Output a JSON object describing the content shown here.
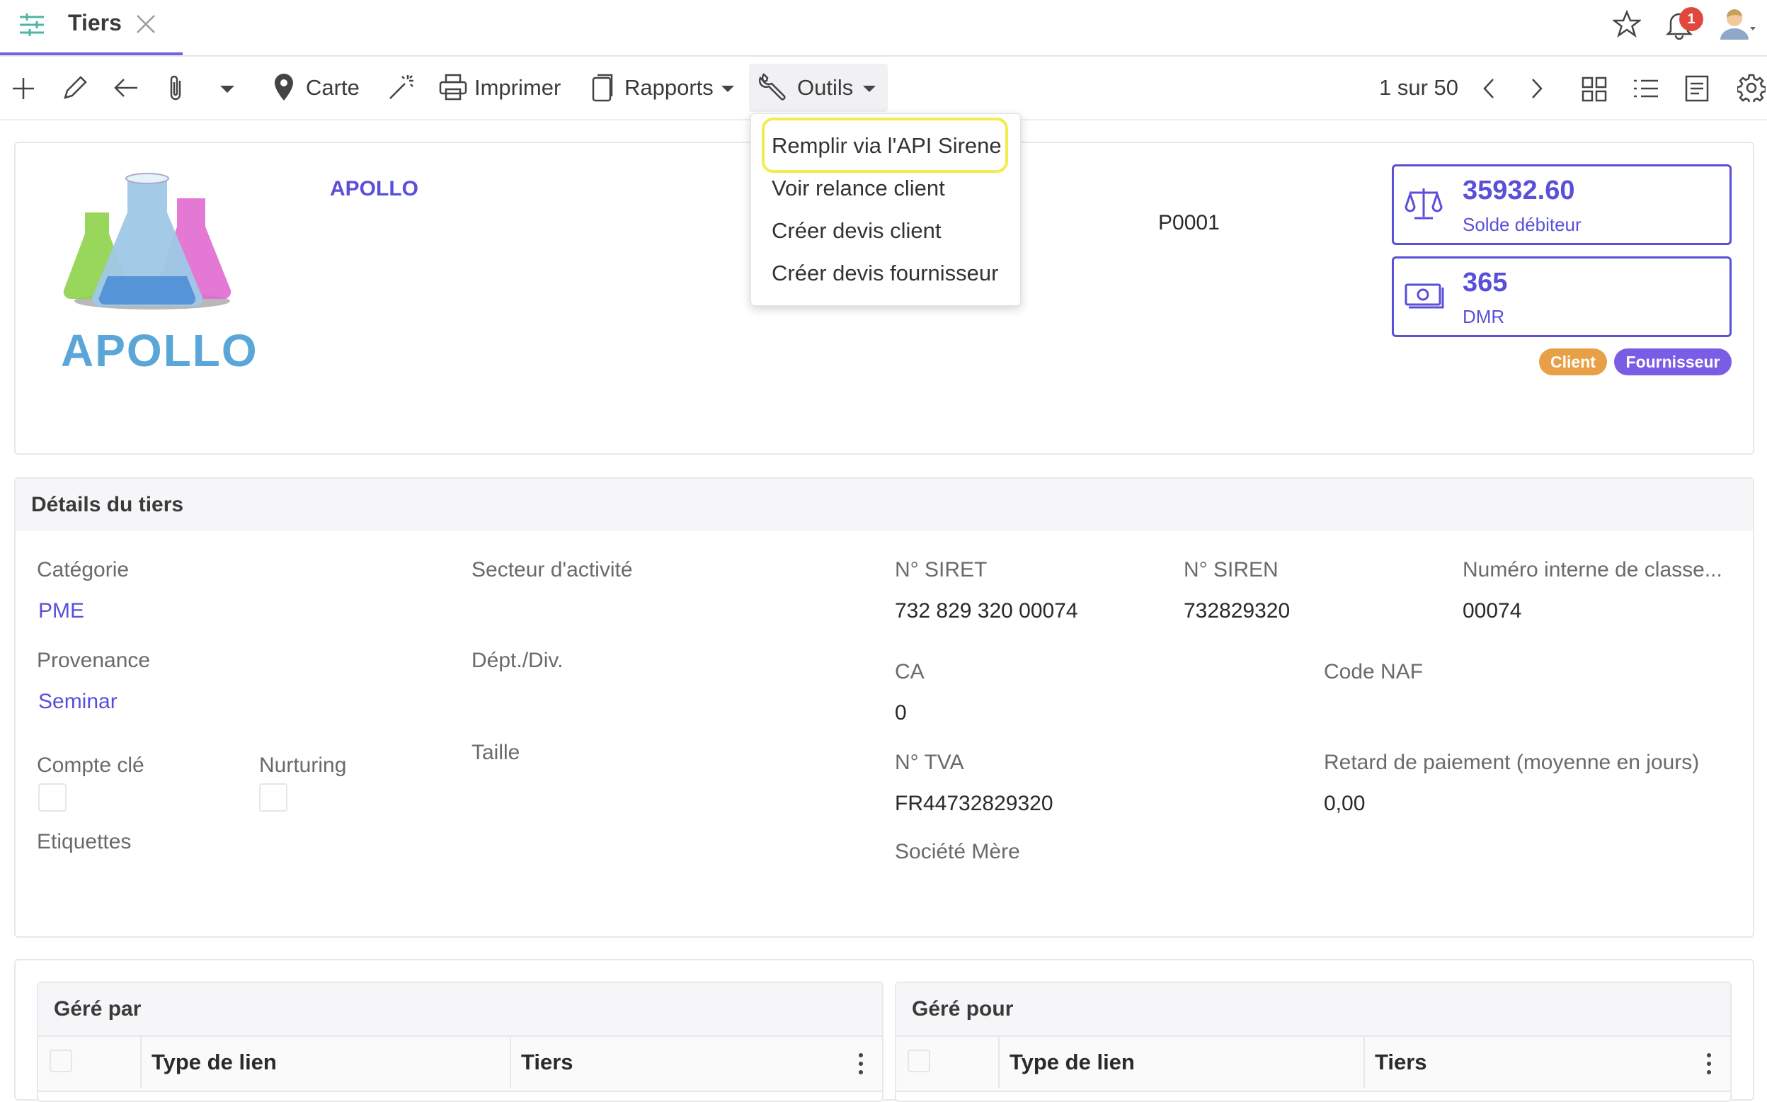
{
  "tab": {
    "title": "Tiers"
  },
  "header": {
    "notifications_count": "1"
  },
  "toolbar": {
    "carte": "Carte",
    "imprimer": "Imprimer",
    "rapports": "Rapports",
    "outils": "Outils",
    "pagination": "1 sur 50"
  },
  "outils_menu": {
    "items": [
      "Remplir via l'API Sirene",
      "Voir relance client",
      "Créer devis client",
      "Créer devis fournisseur"
    ]
  },
  "partner": {
    "logo_text": "APOLLO",
    "name": "APOLLO",
    "code": "P0001"
  },
  "kpis": [
    {
      "value": "35932.60",
      "label": "Solde débiteur",
      "icon": "balance-scale-icon"
    },
    {
      "value": "365",
      "label": "DMR",
      "icon": "money-icon"
    }
  ],
  "badges": [
    {
      "label": "Client",
      "color": "#e8a046"
    },
    {
      "label": "Fournisseur",
      "color": "#7b5ce5"
    }
  ],
  "details": {
    "title": "Détails du tiers",
    "categorie_label": "Catégorie",
    "categorie_value": "PME",
    "secteur_label": "Secteur d'activité",
    "siret_label": "N° SIRET",
    "siret_value": "732 829 320 00074",
    "siren_label": "N° SIREN",
    "siren_value": "732829320",
    "numero_interne_label": "Numéro interne de classe...",
    "numero_interne_value": "00074",
    "provenance_label": "Provenance",
    "provenance_value": "Seminar",
    "dept_label": "Dépt./Div.",
    "ca_label": "CA",
    "ca_value": "0",
    "code_naf_label": "Code NAF",
    "compte_cle_label": "Compte clé",
    "nurturing_label": "Nurturing",
    "taille_label": "Taille",
    "tva_label": "N° TVA",
    "tva_value": "FR44732829320",
    "retard_label": "Retard de paiement (moyenne en jours)",
    "retard_value": "0,00",
    "etiquettes_label": "Etiquettes",
    "societe_mere_label": "Société Mère"
  },
  "gere_par": {
    "title": "Géré par",
    "col_type": "Type de lien",
    "col_tiers": "Tiers"
  },
  "gere_pour": {
    "title": "Géré pour",
    "col_type": "Type de lien",
    "col_tiers": "Tiers"
  },
  "colors": {
    "accent": "#5a4fd8",
    "highlight": "#f2ec4e",
    "notif": "#e0483e"
  }
}
